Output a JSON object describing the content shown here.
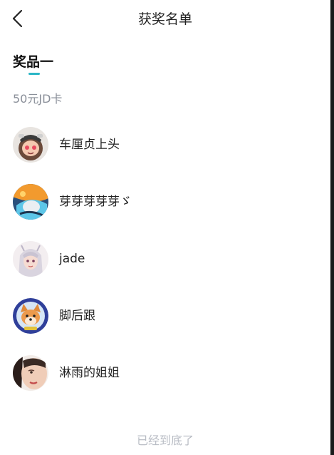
{
  "header": {
    "title": "获奖名单",
    "back_icon": "chevron-left-icon"
  },
  "tabs": [
    {
      "label": "奖品一",
      "active": true
    }
  ],
  "prize": {
    "name": "50元JD卡"
  },
  "winners": [
    {
      "name": "车厘贞上头",
      "avatar": "avatar-anime-girl-helmet"
    },
    {
      "name": "芽芽芽芽芽ゞ",
      "avatar": "avatar-anime-blue-fire"
    },
    {
      "name": "jade",
      "avatar": "avatar-anime-girl-silver-hair"
    },
    {
      "name": "脚后跟",
      "avatar": "avatar-shiba-dog"
    },
    {
      "name": "淋雨的姐姐",
      "avatar": "avatar-portrait-face"
    }
  ],
  "footer": {
    "end_text": "已经到底了"
  },
  "colors": {
    "accent": "#2bb6c6",
    "muted_text": "#8a8f99",
    "footer_text": "#b8bcc4"
  }
}
